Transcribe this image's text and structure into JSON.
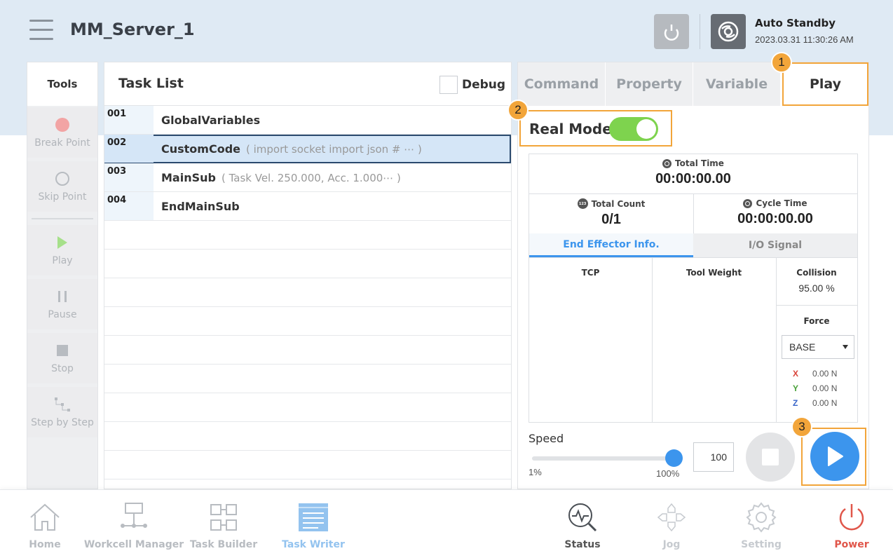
{
  "header": {
    "title": "MM_Server_1",
    "status_title": "Auto Standby",
    "status_time": "2023.03.31 11:30:26 AM"
  },
  "tools": {
    "title": "Tools",
    "items": [
      {
        "label": "Break Point",
        "icon": "break-point-icon"
      },
      {
        "label": "Skip Point",
        "icon": "skip-point-icon"
      },
      {
        "label": "Play",
        "icon": "play-icon"
      },
      {
        "label": "Pause",
        "icon": "pause-icon"
      },
      {
        "label": "Stop",
        "icon": "stop-icon"
      },
      {
        "label": "Step by Step",
        "icon": "step-icon"
      }
    ]
  },
  "tasklist": {
    "title": "Task List",
    "debug_label": "Debug",
    "rows": [
      {
        "num": "001",
        "name": "GlobalVariables",
        "desc": ""
      },
      {
        "num": "002",
        "name": "CustomCode",
        "desc": "( import socket import json # ⋯ )"
      },
      {
        "num": "003",
        "name": "MainSub",
        "desc": "( Task Vel. 250.000, Acc. 1.000⋯ )"
      },
      {
        "num": "004",
        "name": "EndMainSub",
        "desc": ""
      }
    ]
  },
  "right": {
    "tabs": [
      "Command",
      "Property",
      "Variable",
      "Play"
    ],
    "real_mode_label": "Real Mode",
    "total_time_label": "Total Time",
    "total_time": "00:00:00.00",
    "total_count_label": "Total Count",
    "count_icon_text": "123",
    "total_count": "0/1",
    "cycle_time_label": "Cycle Time",
    "cycle_time": "00:00:00.00",
    "subtabs": [
      "End Effector Info.",
      "I/O Signal"
    ],
    "tcp_label": "TCP",
    "tool_weight_label": "Tool Weight",
    "collision_label": "Collision",
    "collision_value": "95.00 %",
    "force_label": "Force",
    "force_select": "BASE",
    "force": [
      {
        "axis": "X",
        "value": "0.00 N"
      },
      {
        "axis": "Y",
        "value": "0.00 N"
      },
      {
        "axis": "Z",
        "value": "0.00 N"
      }
    ],
    "speed_label": "Speed",
    "speed_min": "1%",
    "speed_max": "100%",
    "speed_value": "100"
  },
  "badges": [
    "1",
    "2",
    "3"
  ],
  "nav": [
    {
      "label": "Home",
      "icon": "home-icon"
    },
    {
      "label": "Workcell Manager",
      "icon": "workcell-icon"
    },
    {
      "label": "Task Builder",
      "icon": "task-builder-icon"
    },
    {
      "label": "Task Writer",
      "icon": "task-writer-icon"
    },
    {
      "label": "Status",
      "icon": "status-icon"
    },
    {
      "label": "Jog",
      "icon": "jog-icon"
    },
    {
      "label": "Setting",
      "icon": "gear-icon"
    },
    {
      "label": "Power",
      "icon": "power-icon"
    }
  ],
  "colors": {
    "accent": "#3c95ed",
    "highlight": "#f2a53a",
    "toggle_on": "#7ed34e",
    "power": "#e0564a",
    "header_bg": "#dfeaf4"
  }
}
